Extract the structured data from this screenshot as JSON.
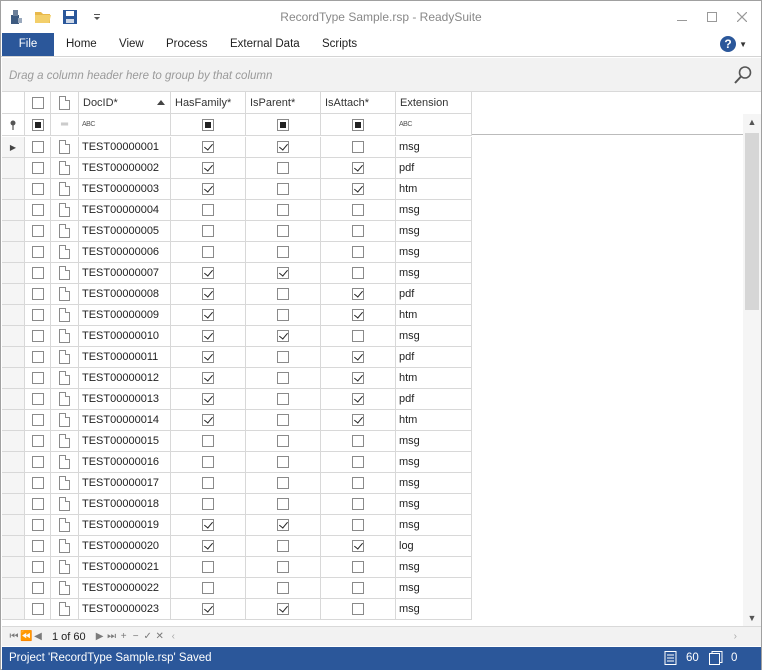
{
  "window": {
    "title": "RecordType Sample.rsp - ReadySuite",
    "controls": [
      "minimize-icon",
      "maximize-icon",
      "close-icon"
    ]
  },
  "quick_access": [
    "app-icon",
    "open-folder-icon",
    "save-icon",
    "customize-dropdown-icon"
  ],
  "ribbon": {
    "file_tab": "File",
    "tabs": [
      "Home",
      "View",
      "Process",
      "External Data",
      "Scripts"
    ],
    "help_label": "?"
  },
  "group_panel": {
    "hint": "Drag a column header here to group by that column"
  },
  "grid": {
    "columns": [
      "DocID*",
      "HasFamily*",
      "IsParent*",
      "IsAttach*",
      "Extension"
    ],
    "sorted_column": "DocID*",
    "sort_direction": "ascending",
    "filter_abc": "ABC",
    "rows": [
      {
        "docid": "TEST00000001",
        "hasfamily": true,
        "isparent": true,
        "isattach": false,
        "ext": "msg"
      },
      {
        "docid": "TEST00000002",
        "hasfamily": true,
        "isparent": false,
        "isattach": true,
        "ext": "pdf"
      },
      {
        "docid": "TEST00000003",
        "hasfamily": true,
        "isparent": false,
        "isattach": true,
        "ext": "htm"
      },
      {
        "docid": "TEST00000004",
        "hasfamily": false,
        "isparent": false,
        "isattach": false,
        "ext": "msg"
      },
      {
        "docid": "TEST00000005",
        "hasfamily": false,
        "isparent": false,
        "isattach": false,
        "ext": "msg"
      },
      {
        "docid": "TEST00000006",
        "hasfamily": false,
        "isparent": false,
        "isattach": false,
        "ext": "msg"
      },
      {
        "docid": "TEST00000007",
        "hasfamily": true,
        "isparent": true,
        "isattach": false,
        "ext": "msg"
      },
      {
        "docid": "TEST00000008",
        "hasfamily": true,
        "isparent": false,
        "isattach": true,
        "ext": "pdf"
      },
      {
        "docid": "TEST00000009",
        "hasfamily": true,
        "isparent": false,
        "isattach": true,
        "ext": "htm"
      },
      {
        "docid": "TEST00000010",
        "hasfamily": true,
        "isparent": true,
        "isattach": false,
        "ext": "msg"
      },
      {
        "docid": "TEST00000011",
        "hasfamily": true,
        "isparent": false,
        "isattach": true,
        "ext": "pdf"
      },
      {
        "docid": "TEST00000012",
        "hasfamily": true,
        "isparent": false,
        "isattach": true,
        "ext": "htm"
      },
      {
        "docid": "TEST00000013",
        "hasfamily": true,
        "isparent": false,
        "isattach": true,
        "ext": "pdf"
      },
      {
        "docid": "TEST00000014",
        "hasfamily": true,
        "isparent": false,
        "isattach": true,
        "ext": "htm"
      },
      {
        "docid": "TEST00000015",
        "hasfamily": false,
        "isparent": false,
        "isattach": false,
        "ext": "msg"
      },
      {
        "docid": "TEST00000016",
        "hasfamily": false,
        "isparent": false,
        "isattach": false,
        "ext": "msg"
      },
      {
        "docid": "TEST00000017",
        "hasfamily": false,
        "isparent": false,
        "isattach": false,
        "ext": "msg"
      },
      {
        "docid": "TEST00000018",
        "hasfamily": false,
        "isparent": false,
        "isattach": false,
        "ext": "msg"
      },
      {
        "docid": "TEST00000019",
        "hasfamily": true,
        "isparent": true,
        "isattach": false,
        "ext": "msg"
      },
      {
        "docid": "TEST00000020",
        "hasfamily": true,
        "isparent": false,
        "isattach": true,
        "ext": "log"
      },
      {
        "docid": "TEST00000021",
        "hasfamily": false,
        "isparent": false,
        "isattach": false,
        "ext": "msg"
      },
      {
        "docid": "TEST00000022",
        "hasfamily": false,
        "isparent": false,
        "isattach": false,
        "ext": "msg"
      },
      {
        "docid": "TEST00000023",
        "hasfamily": true,
        "isparent": true,
        "isattach": false,
        "ext": "msg"
      }
    ]
  },
  "navigator": {
    "page_info": "1 of 60",
    "buttons": [
      "first-record-icon",
      "prev-page-icon",
      "prev-record-icon",
      "next-record-icon",
      "next-page-icon",
      "last-record-icon",
      "append-icon",
      "delete-icon",
      "end-edit-icon",
      "cancel-edit-icon"
    ]
  },
  "status_bar": {
    "message": "Project 'RecordType Sample.rsp' Saved",
    "record_count": "60",
    "selected_count": "0"
  },
  "colors": {
    "accent": "#2b579a",
    "grid_line": "#d8d8d8",
    "panel_bg": "#f2f2f2"
  }
}
